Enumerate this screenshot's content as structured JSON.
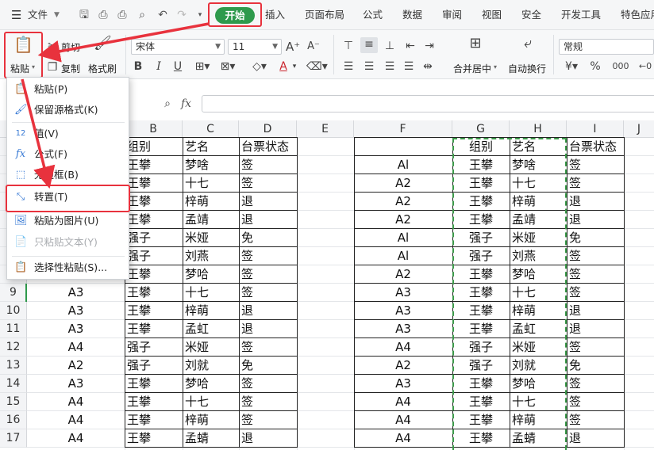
{
  "menubar": {
    "file_label": "文件",
    "tabs": [
      "开始",
      "插入",
      "页面布局",
      "公式",
      "数据",
      "审阅",
      "视图",
      "安全",
      "开发工具",
      "特色应用"
    ]
  },
  "ribbon": {
    "paste": "粘贴",
    "cut": "剪切",
    "copy": "复制",
    "format_painter": "格式刷",
    "font_name": "宋体",
    "font_size": "11",
    "merge_center": "合并居中",
    "wrap_text": "自动换行",
    "number_format": "常规",
    "bold": "B",
    "italic": "I",
    "underline": "U",
    "font_color_glyph": "A",
    "percent": "%",
    "comma": "000"
  },
  "formula_bar": {
    "fx": "fx",
    "value": ""
  },
  "paste_menu": {
    "items": [
      "粘贴(P)",
      "保留源格式(K)",
      "值(V)",
      "公式(F)",
      "无边框(B)",
      "转置(T)",
      "粘贴为图片(U)",
      "只粘贴文本(Y)",
      "选择性粘贴(S)..."
    ]
  },
  "grid": {
    "columns": [
      "B",
      "C",
      "D",
      "E",
      "F",
      "G",
      "H",
      "I",
      "J"
    ],
    "rows": [
      {
        "n": "",
        "a": "",
        "b": "组别",
        "c": "艺名",
        "d": "台票状态",
        "f": "",
        "g": "组别",
        "h": "艺名",
        "i": "台票状态"
      },
      {
        "n": "",
        "a": "",
        "b": "王攀",
        "c": "梦啥",
        "d": "签",
        "f": "Al",
        "g": "王攀",
        "h": "梦啥",
        "i": "签"
      },
      {
        "n": "",
        "a": "",
        "b": "王攀",
        "c": "十七",
        "d": "签",
        "f": "A2",
        "g": "王攀",
        "h": "十七",
        "i": "签"
      },
      {
        "n": "",
        "a": "",
        "b": "王攀",
        "c": "梓萌",
        "d": "退",
        "f": "A2",
        "g": "王攀",
        "h": "梓萌",
        "i": "退"
      },
      {
        "n": "",
        "a": "",
        "b": "王攀",
        "c": "孟靖",
        "d": "退",
        "f": "A2",
        "g": "王攀",
        "h": "孟靖",
        "i": "退"
      },
      {
        "n": "",
        "a": "",
        "b": "强子",
        "c": "米娅",
        "d": "免",
        "f": "Al",
        "g": "强子",
        "h": "米娅",
        "i": "免"
      },
      {
        "n": "",
        "a": "",
        "b": "强子",
        "c": "刘燕",
        "d": "签",
        "f": "Al",
        "g": "强子",
        "h": "刘燕",
        "i": "签"
      },
      {
        "n": "",
        "a": "",
        "b": "王攀",
        "c": "梦哈",
        "d": "签",
        "f": "A2",
        "g": "王攀",
        "h": "梦哈",
        "i": "签"
      },
      {
        "n": "9",
        "a": "A3",
        "b": "王攀",
        "c": "十七",
        "d": "签",
        "f": "A3",
        "g": "王攀",
        "h": "十七",
        "i": "签"
      },
      {
        "n": "10",
        "a": "A3",
        "b": "王攀",
        "c": "梓萌",
        "d": "退",
        "f": "A3",
        "g": "王攀",
        "h": "梓萌",
        "i": "退"
      },
      {
        "n": "11",
        "a": "A3",
        "b": "王攀",
        "c": "孟虹",
        "d": "退",
        "f": "A3",
        "g": "王攀",
        "h": "孟虹",
        "i": "退"
      },
      {
        "n": "12",
        "a": "A4",
        "b": "强子",
        "c": "米娅",
        "d": "签",
        "f": "A4",
        "g": "强子",
        "h": "米娅",
        "i": "签"
      },
      {
        "n": "13",
        "a": "A2",
        "b": "强子",
        "c": "刘就",
        "d": "免",
        "f": "A2",
        "g": "强子",
        "h": "刘就",
        "i": "免"
      },
      {
        "n": "14",
        "a": "A3",
        "b": "王攀",
        "c": "梦哈",
        "d": "签",
        "f": "A3",
        "g": "王攀",
        "h": "梦哈",
        "i": "签"
      },
      {
        "n": "15",
        "a": "A4",
        "b": "王攀",
        "c": "十七",
        "d": "签",
        "f": "A4",
        "g": "王攀",
        "h": "十七",
        "i": "签"
      },
      {
        "n": "16",
        "a": "A4",
        "b": "王攀",
        "c": "梓萌",
        "d": "签",
        "f": "A4",
        "g": "王攀",
        "h": "梓萌",
        "i": "签"
      },
      {
        "n": "17",
        "a": "A4",
        "b": "王攀",
        "c": "孟蜻",
        "d": "退",
        "f": "A4",
        "g": "王攀",
        "h": "孟蜻",
        "i": "退"
      }
    ]
  },
  "colors": {
    "accent_green": "#2e9a4c",
    "highlight_red": "#e8323d",
    "marquee_green": "#3c9a4a"
  }
}
